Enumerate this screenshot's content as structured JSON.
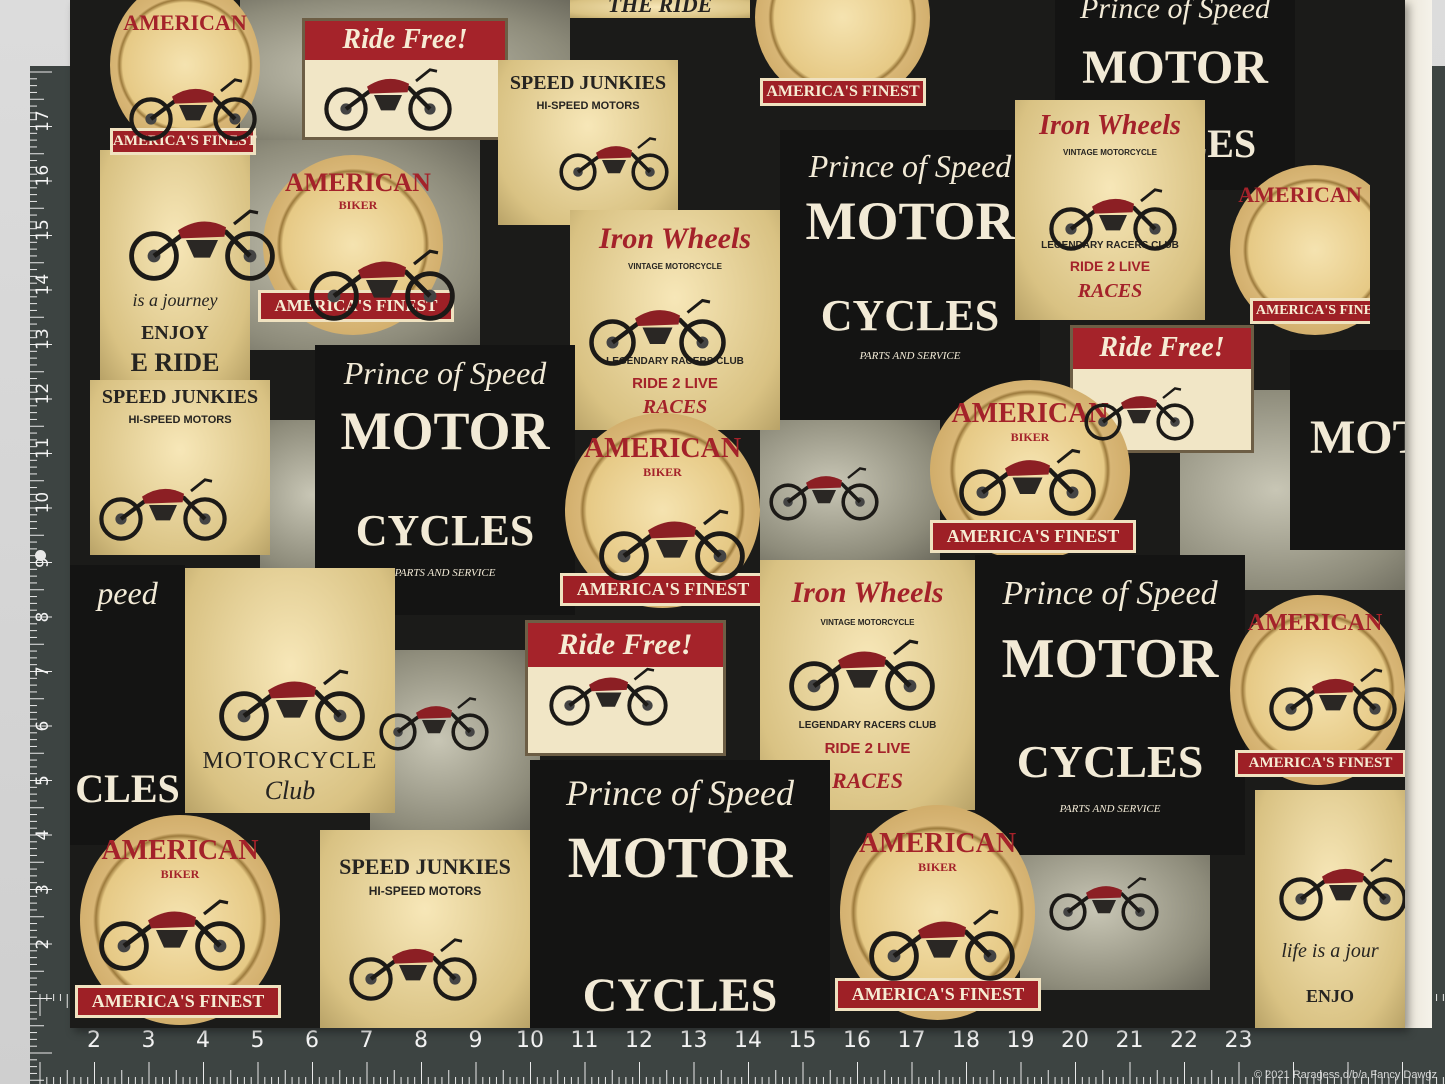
{
  "image": {
    "subject": "Motorcycle-themed printed cotton fabric laid on a cutting mat",
    "colors": {
      "mat": "#3d4442",
      "fabric_black": "#141413",
      "tan": "#e6cf93",
      "red": "#a4222a",
      "cream": "#f2ead6"
    }
  },
  "ruler": {
    "vertical_labels": [
      "17",
      "16",
      "15",
      "14",
      "13",
      "12",
      "11",
      "10",
      "9",
      "8",
      "7",
      "6",
      "5",
      "4",
      "3",
      "2"
    ],
    "horizontal_labels": [
      "2",
      "3",
      "4",
      "5",
      "6",
      "7",
      "8",
      "9",
      "10",
      "11",
      "12",
      "13",
      "14",
      "15",
      "16",
      "17",
      "18",
      "19",
      "20",
      "21",
      "22",
      "23"
    ]
  },
  "prints": {
    "the_ride": "THE RIDE",
    "american": "AMERICAN",
    "biker": "BIKER",
    "americas_finest": "AMERICA'S FINEST",
    "ride_free": "Ride Free!",
    "speed_junkies": "SPEED JUNKIES",
    "hi_speed_motors": "HI-SPEED MOTORS",
    "prince_of_speed": "Prince of Speed",
    "motor": "MOTOR",
    "cycles": "CYCLES",
    "parts_service": "PARTS AND SERVICE",
    "iron_wheels": "Iron Wheels",
    "vintage_motorcycle": "VINTAGE MOTORCYCLE",
    "legendary_racers_club": "LEGENDARY RACERS CLUB",
    "ride_2_live": "RIDE 2 LIVE",
    "races": "RACES",
    "is_a_journey": "is a journey",
    "enjoy": "ENJOY",
    "e_ride": "E RIDE",
    "motorcycle": "MOTORCYCLE",
    "club": "Club",
    "life_is_a_jour": "life is a jour",
    "partial_peed": "peed",
    "partial_cles": "CLES",
    "partial_enjo": "ENJO"
  },
  "watermark": "© 2021 Raragess d/b/a Fancy Dawgz"
}
